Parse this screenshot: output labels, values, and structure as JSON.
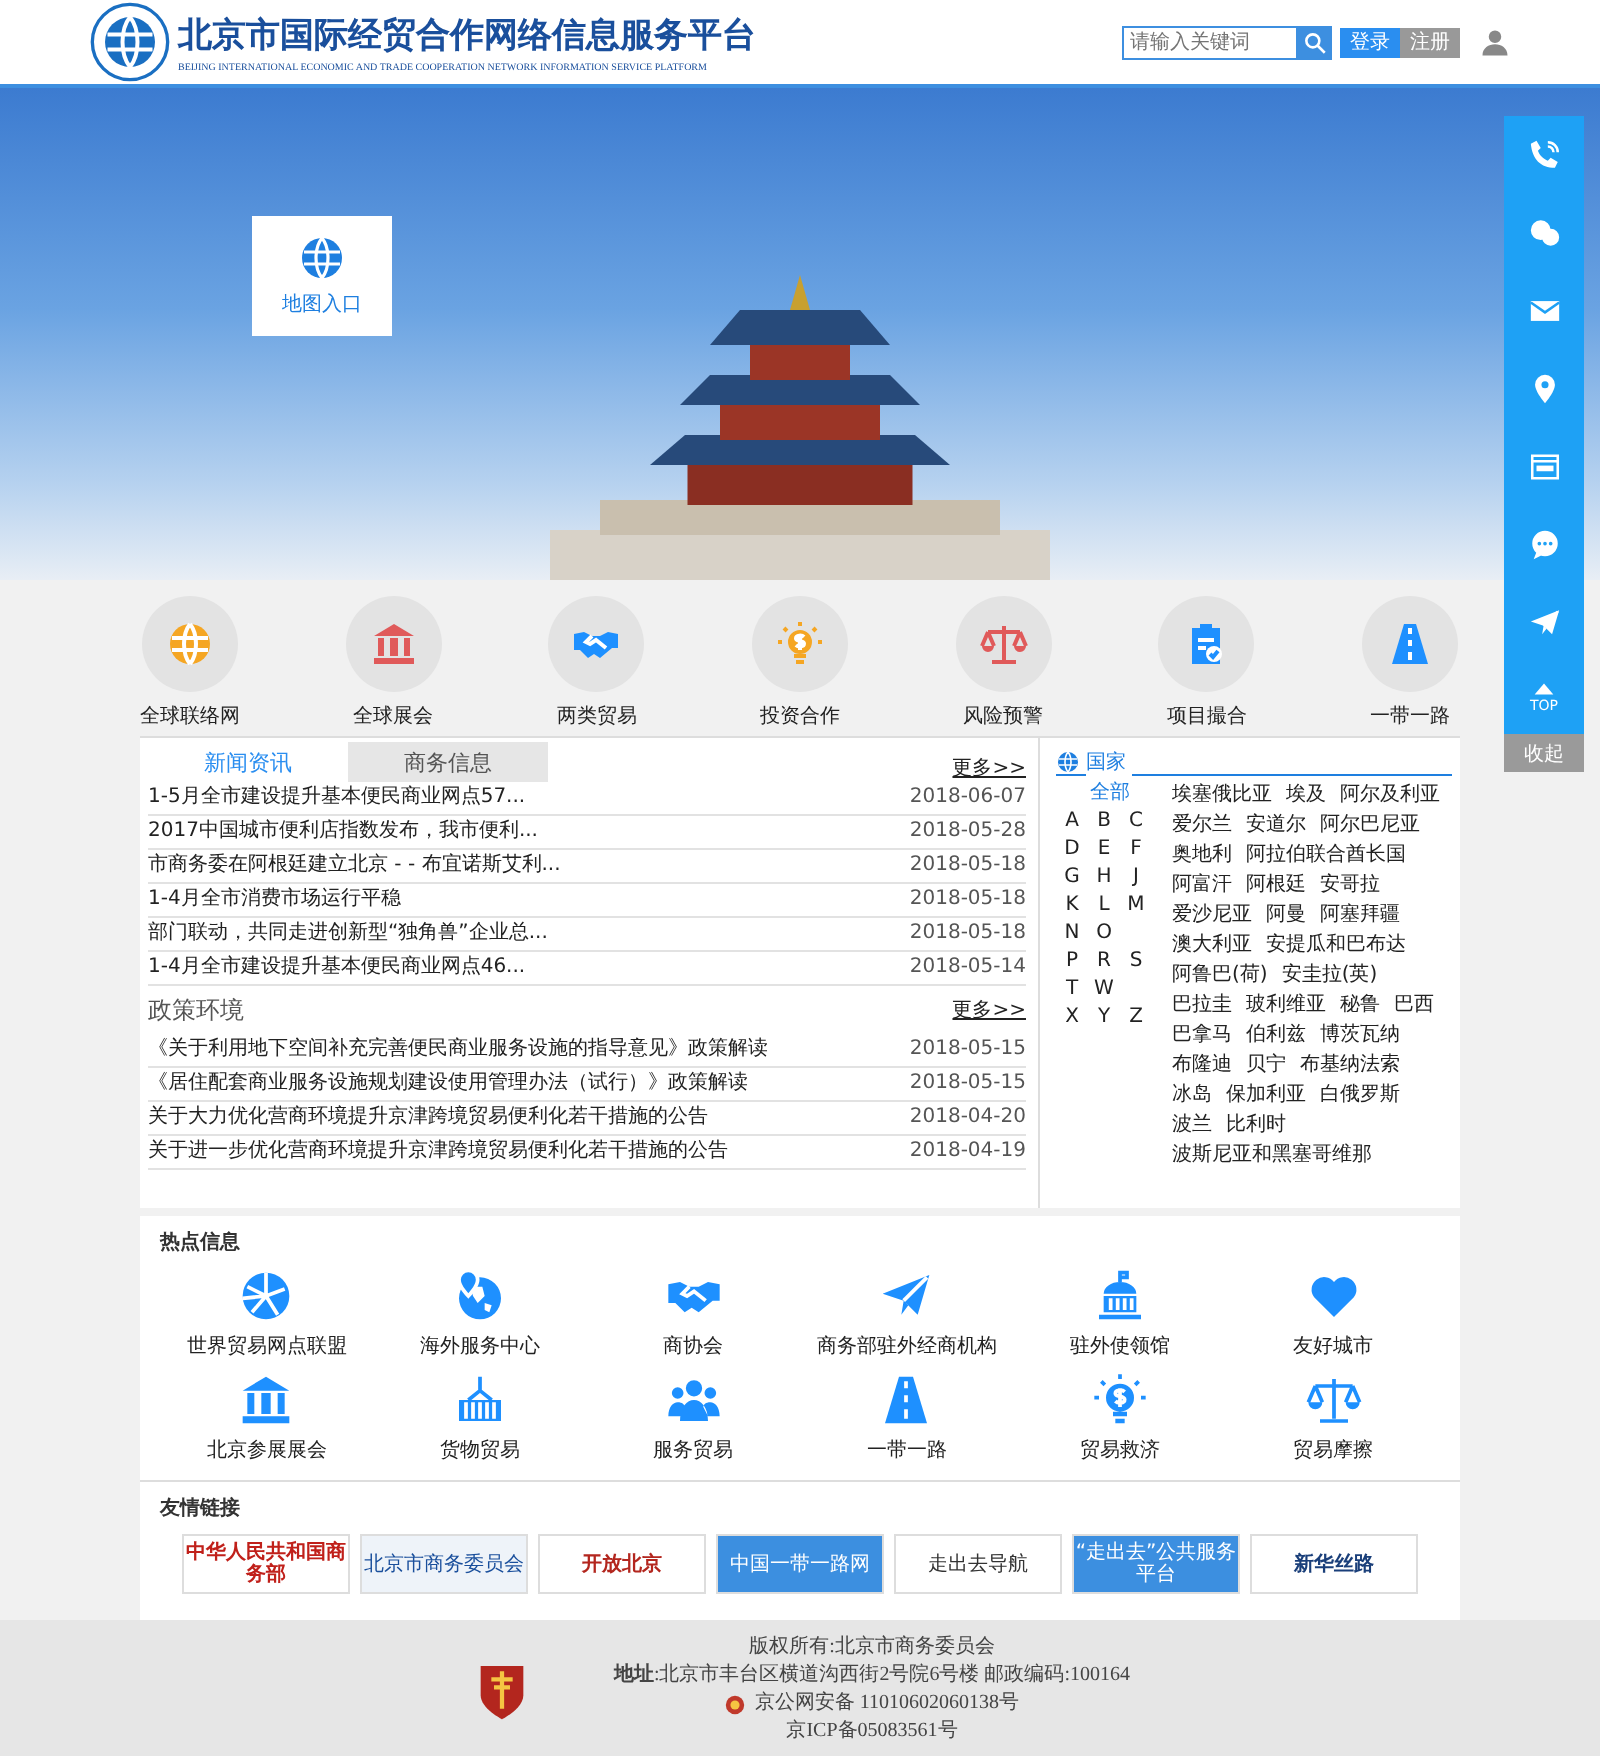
{
  "header": {
    "title": "北京市国际经贸合作网络信息服务平台",
    "subtitle": "BEIJING INTERNATIONAL ECONOMIC AND TRADE COOPERATION NETWORK INFORMATION SERVICE PLATFORM",
    "search": {
      "placeholder": "请输入关键词"
    },
    "buttons": [
      {
        "label": "登录",
        "kind": "primary"
      },
      {
        "label": "注册",
        "kind": "secondary"
      }
    ]
  },
  "banner": {
    "map_entry": "地图入口"
  },
  "side_toolbar": {
    "top_label": "TOP",
    "collapse": "收起"
  },
  "categories": [
    "全球联络网",
    "全球展会",
    "两类贸易",
    "投资合作",
    "风险预警",
    "项目撮合",
    "一带一路"
  ],
  "news": {
    "tabs": [
      {
        "label": "新闻资讯",
        "selected": true
      },
      {
        "label": "商务信息",
        "selected": false
      }
    ],
    "more": "更多>>",
    "items": [
      {
        "title": "1-5月全市建设提升基本便民商业网点57...",
        "date": "2018-06-07"
      },
      {
        "title": "2017中国城市便利店指数发布，我市便利...",
        "date": "2018-05-28"
      },
      {
        "title": "市商务委在阿根廷建立北京 - - 布宜诺斯艾利...",
        "date": "2018-05-18"
      },
      {
        "title": "1-4月全市消费市场运行平稳",
        "date": "2018-05-18"
      },
      {
        "title": "部门联动，共同走进创新型“独角兽”企业总...",
        "date": "2018-05-18"
      },
      {
        "title": "1-4月全市建设提升基本便民商业网点46...",
        "date": "2018-05-14"
      }
    ]
  },
  "policy": {
    "title": "政策环境",
    "more": "更多>>",
    "items": [
      {
        "title": "《关于利用地下空间补充完善便民商业服务设施的指导意见》政策解读",
        "date": "2018-05-15"
      },
      {
        "title": "《居住配套商业服务设施规划建设使用管理办法（试行）》政策解读",
        "date": "2018-05-15"
      },
      {
        "title": "关于大力优化营商环境提升京津跨境贸易便利化若干措施的公告",
        "date": "2018-04-20"
      },
      {
        "title": "关于进一步优化营商环境提升京津跨境贸易便利化若干措施的公告",
        "date": "2018-04-19"
      }
    ]
  },
  "countries": {
    "title": "国家",
    "all": "全部",
    "letters": [
      [
        "A",
        "B",
        "C"
      ],
      [
        "D",
        "E",
        "F"
      ],
      [
        "G",
        "H",
        "J"
      ],
      [
        "K",
        "L",
        "M"
      ],
      [
        "N",
        "O"
      ],
      [
        "P",
        "R",
        "S"
      ],
      [
        "T",
        "W"
      ],
      [
        "X",
        "Y",
        "Z"
      ]
    ],
    "names": [
      [
        "埃塞俄比亚",
        "埃及",
        "阿尔及利亚"
      ],
      [
        "爱尔兰",
        "安道尔",
        "阿尔巴尼亚"
      ],
      [
        "奥地利",
        "阿拉伯联合酋长国"
      ],
      [
        "阿富汗",
        "阿根廷",
        "安哥拉"
      ],
      [
        "爱沙尼亚",
        "阿曼",
        "阿塞拜疆"
      ],
      [
        "澳大利亚",
        "安提瓜和巴布达"
      ],
      [
        "阿鲁巴(荷)",
        "安圭拉(英)"
      ],
      [
        "巴拉圭",
        "玻利维亚",
        "秘鲁",
        "巴西"
      ],
      [
        "巴拿马",
        "伯利兹",
        "博茨瓦纳"
      ],
      [
        "布隆迪",
        "贝宁",
        "布基纳法索"
      ],
      [
        "冰岛",
        "保加利亚",
        "白俄罗斯"
      ],
      [
        "波兰",
        "比利时"
      ],
      [
        "波斯尼亚和黑塞哥维那"
      ]
    ]
  },
  "hot_info": {
    "title": "热点信息",
    "items": [
      "世界贸易网点联盟",
      "海外服务中心",
      "商协会",
      "商务部驻外经商机构",
      "驻外使领馆",
      "友好城市",
      "北京参展展会",
      "货物贸易",
      "服务贸易",
      "一带一路",
      "贸易救济",
      "贸易摩擦"
    ]
  },
  "links": {
    "title": "友情链接",
    "items": [
      "中华人民共和国商务部",
      "北京市商务委员会",
      "开放北京",
      "中国一带一路网",
      "走出去导航",
      "“走出去”公共服务平台",
      "新华丝路"
    ]
  },
  "footer": {
    "copyright": "版权所有:北京市商务委员会",
    "address": "**地址**:北京市丰台区横道沟西街2号院6号楼  邮政编码:100164",
    "police": "京公网安备  11010602060138号",
    "icp": "京ICP备05083561号"
  }
}
